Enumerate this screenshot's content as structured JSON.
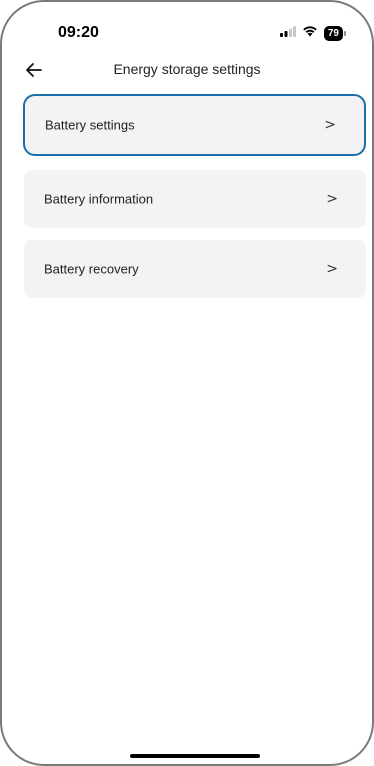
{
  "status_bar": {
    "time": "09:20",
    "battery_level": "79",
    "signal_icon": "signal-bars-icon",
    "wifi_icon": "wifi-icon"
  },
  "header": {
    "back_icon": "arrow-left-icon",
    "title": "Energy storage settings"
  },
  "menu": {
    "items": [
      {
        "label": "Battery settings",
        "chevron": ">"
      },
      {
        "label": "Battery information",
        "chevron": ">"
      },
      {
        "label": "Battery recovery",
        "chevron": ">"
      }
    ]
  },
  "colors": {
    "selected_border": "#1a6fa8",
    "item_background": "#f3f3f5"
  }
}
